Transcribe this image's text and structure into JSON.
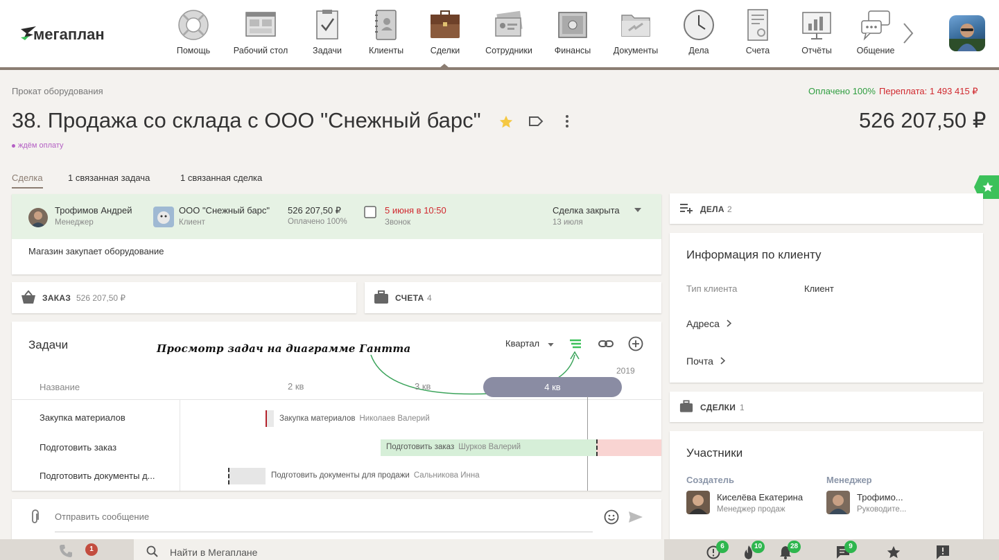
{
  "nav": {
    "logo_text": "мегаплан",
    "items": [
      {
        "label": "Помощь",
        "icon": "lifebuoy-icon"
      },
      {
        "label": "Рабочий стол",
        "icon": "desktop-icon"
      },
      {
        "label": "Задачи",
        "icon": "tasks-clipboard-icon"
      },
      {
        "label": "Клиенты",
        "icon": "contacts-book-icon"
      },
      {
        "label": "Сделки",
        "icon": "briefcase-icon"
      },
      {
        "label": "Сотрудники",
        "icon": "employee-cards-icon"
      },
      {
        "label": "Финансы",
        "icon": "safe-icon"
      },
      {
        "label": "Документы",
        "icon": "folder-icon"
      },
      {
        "label": "Дела",
        "icon": "clock-icon"
      },
      {
        "label": "Счета",
        "icon": "invoice-icon"
      },
      {
        "label": "Отчёты",
        "icon": "report-chart-icon"
      },
      {
        "label": "Общение",
        "icon": "chat-bubbles-icon"
      }
    ],
    "active": "Сделки"
  },
  "header": {
    "breadcrumb": "Прокат оборудования",
    "paid_status": "Оплачено 100%",
    "overpay": "Переплата: 1 493 415 ₽",
    "title": "38. Продажа со склада с ООО \"Снежный барс\"",
    "amount": "526 207,50 ₽",
    "status": "ждём оплату"
  },
  "tabs": [
    "Сделка",
    "1 связанная задача",
    "1 связанная сделка"
  ],
  "deal_card": {
    "manager_name": "Трофимов Андрей",
    "manager_role": "Менеджер",
    "client_name": "ООО \"Снежный барс\"",
    "client_role": "Клиент",
    "sum": "526 207,50 ₽",
    "sum_sub": "Оплачено 100%",
    "event_date": "5 июня в 10:50",
    "event_type": "Звонок",
    "stage": "Сделка закрыта",
    "stage_date": "13 июля",
    "description": "Магазин закупает оборудование"
  },
  "order": {
    "caption": "ЗАКАЗ",
    "value": "526 207,50 ₽"
  },
  "invoices": {
    "caption": "СЧЕТА",
    "count": "4"
  },
  "tasks": {
    "title": "Задачи",
    "hint": "Просмотр задач на диаграмме Гантта",
    "period": "Квартал",
    "year": "2019",
    "col_name": "Название",
    "quarters": [
      "2 кв",
      "3 кв",
      "4 кв"
    ],
    "rows": [
      {
        "name": "Закупка материалов",
        "bar": "Закупка материалов",
        "who": "Николаев Валерий"
      },
      {
        "name": "Подготовить заказ",
        "bar": "Подготовить заказ",
        "who": "Шурков Валерий"
      },
      {
        "name": "Подготовить документы д...",
        "bar": "Подготовить документы для продажи",
        "who": "Сальникова Инна"
      }
    ]
  },
  "chat": {
    "placeholder": "Отправить сообщение"
  },
  "right": {
    "cases_caption": "ДЕЛА",
    "cases_count": "2",
    "client_info_title": "Информация по клиенту",
    "client_type_label": "Тип клиента",
    "client_type_value": "Клиент",
    "addresses": "Адреса",
    "mail": "Почта",
    "deals_caption": "СДЕЛКИ",
    "deals_count": "1",
    "members_title": "Участники",
    "creator_label": "Создатель",
    "creator_name": "Киселёва Екатерина",
    "creator_role": "Менеджер продаж",
    "manager_label": "Менеджер",
    "manager_name": "Трофимо...",
    "manager_role": "Руководите..."
  },
  "bottom": {
    "missed_calls": "1",
    "search_placeholder": "Найти в Мегаплане",
    "alerts": "6",
    "hot": "10",
    "notifications": "28",
    "messages": "9"
  },
  "colors": {
    "accent": "#8b7d72",
    "paid": "#2e9d3f",
    "overpay": "#d0282e",
    "status": "#b45fc4",
    "deal_head": "#e6f2e4",
    "badge": "#2eb64e"
  }
}
